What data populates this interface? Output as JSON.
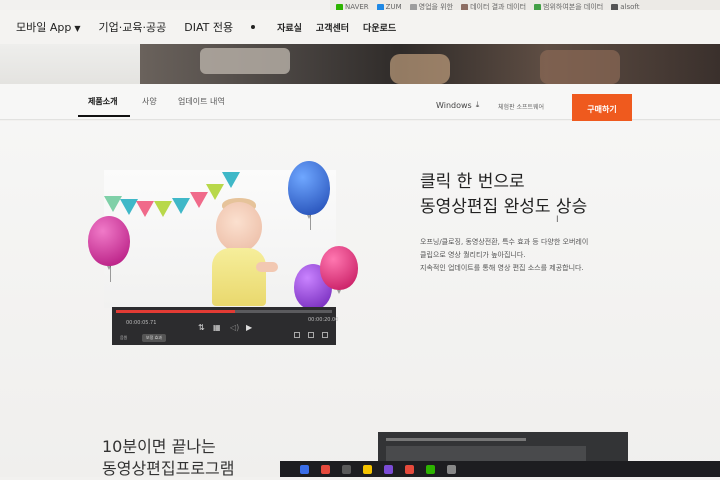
{
  "browser_bookmarks": [
    {
      "label": "NAVER",
      "color": "#2db400"
    },
    {
      "label": "ZUM",
      "color": "#1e88e5"
    },
    {
      "label": "영업을 위한",
      "color": "#9e9e9e"
    },
    {
      "label": "데이터 결과 데이터",
      "color": "#8d6e63"
    },
    {
      "label": "범위하여본을 데이터",
      "color": "#43a047"
    },
    {
      "label": "alsoft",
      "color": "#555555"
    }
  ],
  "top_nav": {
    "mobile_app": "모바일 App",
    "enterprise": "기업·교육·공공",
    "diat": "DIAT 전용",
    "resources": "자료실",
    "support": "고객센터",
    "download": "다운로드"
  },
  "sub_nav": {
    "tabs": [
      "제품소개",
      "사양",
      "업데이트 내역"
    ],
    "active_tab": "제품소개",
    "os": "Windows",
    "trial_text": "체험판 소프트웨어",
    "buy_label": "구매하기",
    "buy_color": "#ef5a1e"
  },
  "hero": {
    "headline_line1": "클릭 한 번으로",
    "headline_line2": "동영상편집 완성도 상승",
    "desc_line1": "오프닝/클로징, 동영상전환, 특수 효과 등 다양한 오버레이",
    "desc_line2": "클립으로 영상 퀄리티가 높아집니다.",
    "desc_line3": "지속적인 업데이트를 통해 영상 편집 소스를 제공합니다."
  },
  "player": {
    "current_time": "00:00:05.71",
    "end_time": "00:00:20.00",
    "progress": 0.55,
    "tag_label": "음원",
    "badge_label": "보정 효과"
  },
  "bottom": {
    "title_line1": "10분이면 끝나는",
    "title_line2": "동영상편집프로그램"
  },
  "icons": {
    "mobile_chevron": "chevron-down-icon",
    "download": "download-icon",
    "play": "play-icon"
  }
}
